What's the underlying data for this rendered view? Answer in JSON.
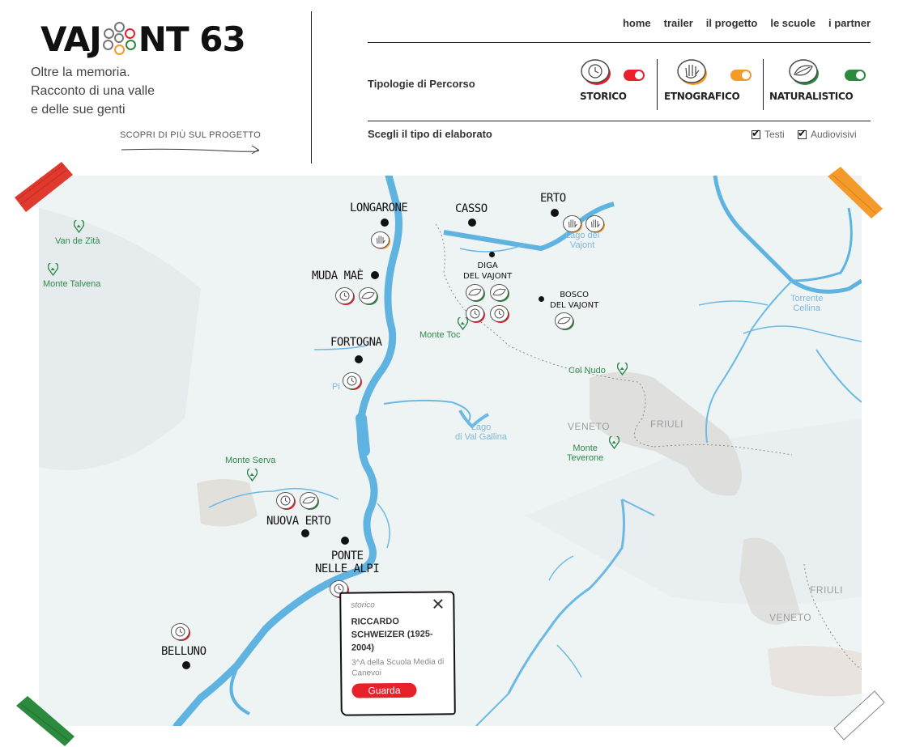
{
  "logo": {
    "prefix": "VAJ",
    "suffix": "NT 63"
  },
  "tagline": [
    "Oltre la memoria.",
    "Racconto di una valle",
    "e delle sue genti"
  ],
  "discover_link": "SCOPRI DI PIÙ SUL PROGETTO",
  "nav": [
    "home",
    "trailer",
    "il progetto",
    "le scuole",
    "i partner"
  ],
  "filters": {
    "label": "Tipologie di Percorso",
    "items": [
      {
        "name": "STORICO",
        "color": "#e8202a",
        "enabled": true,
        "icon": "clock-icon"
      },
      {
        "name": "ETNOGRAFICO",
        "color": "#f39a2a",
        "enabled": true,
        "icon": "hand-icon"
      },
      {
        "name": "NATURALISTICO",
        "color": "#2b8a3e",
        "enabled": true,
        "icon": "leaf-icon"
      }
    ]
  },
  "elaborato": {
    "label": "Scegli il tipo di elaborato",
    "options": [
      {
        "label": "Testi",
        "checked": true
      },
      {
        "label": "Audiovisivi",
        "checked": true
      }
    ]
  },
  "map": {
    "places": {
      "longarone": "LONGARONE",
      "casso": "CASSO",
      "erto": "ERTO",
      "muda": "MUDA MAÈ",
      "fortogna": "FORTOGNA",
      "nuova_erto": "NUOVA ERTO",
      "ponte1": "PONTE",
      "ponte2": "NELLE ALPI",
      "belluno": "BELLUNO",
      "diga1": "DIGA",
      "diga2": "DEL VAJONT",
      "bosco1": "BOSCO",
      "bosco2": "DEL VAJONT"
    },
    "mountains": {
      "van_de_zita": "Van de Zità",
      "talvena": "Monte Talvena",
      "toc": "Monte Toc",
      "col_nudo": "Col Nudo",
      "teverone1": "Monte",
      "teverone2": "Teverone",
      "serva": "Monte Serva"
    },
    "water": {
      "lago_vajont1": "Lago del",
      "lago_vajont2": "Vajont",
      "gallina1": "Lago",
      "gallina2": "di Val Gallina",
      "cellina1": "Torrente",
      "cellina2": "Cellina",
      "pi": "Pi"
    },
    "regions": {
      "veneto1": "VENETO",
      "friuli1": "FRIULI",
      "friuli2": "FRIULI",
      "veneto2": "VENETO"
    }
  },
  "popup": {
    "type": "storico",
    "title": "RICCARDO SCHWEIZER (1925-2004)",
    "subtitle": "3^A della Scuola Media di Canevoi",
    "button": "Guarda"
  }
}
